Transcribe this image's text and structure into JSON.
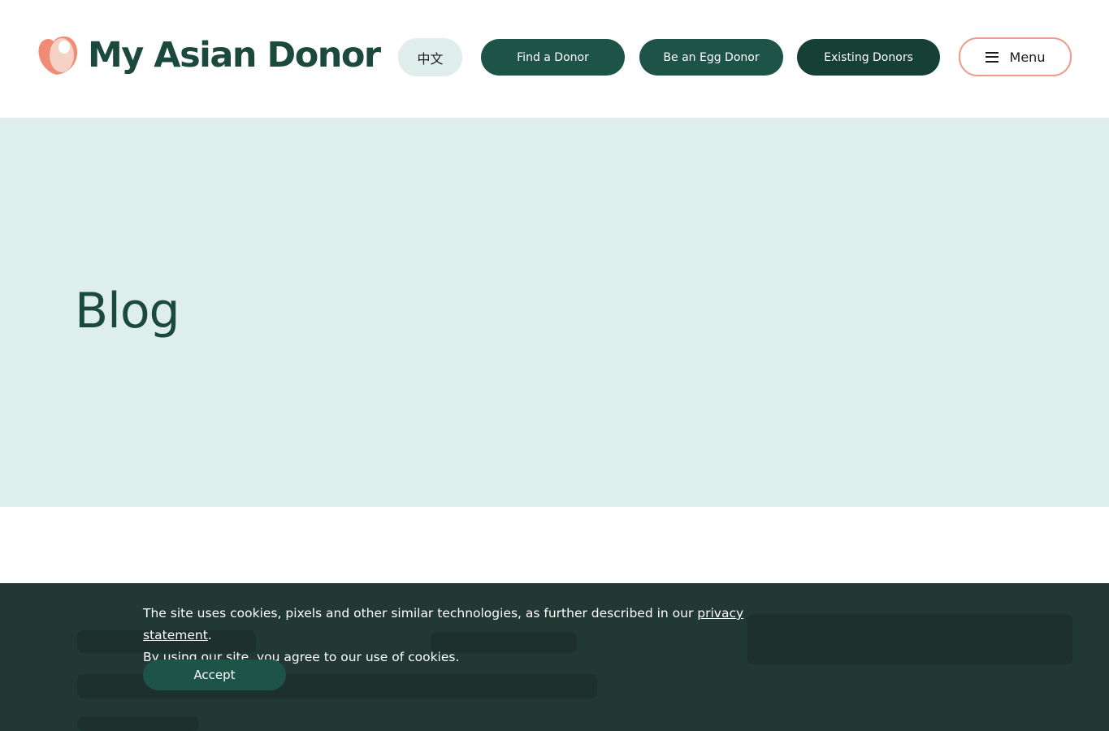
{
  "header": {
    "logo_text": "My Asian Donor",
    "lang_label": "中文",
    "nav": {
      "find_donor": "Find a Donor",
      "egg_donor": "Be an Egg Donor",
      "existing_donors": "Existing Donors"
    },
    "menu_label": "Menu"
  },
  "hero": {
    "title": "Blog"
  },
  "cookie_banner": {
    "text_before_link": "The site uses cookies, pixels and other similar technologies, as further described in our ",
    "link_text": "privacy statement",
    "text_after_link": ".",
    "line2": "By using our site, you agree to our use of cookies.",
    "accept_label": "Accept"
  },
  "colors": {
    "brand_green": "#1e5447",
    "dark_green": "#163f36",
    "hero_bg": "#deeeea",
    "accent_coral": "#ee9c8a",
    "cookie_bg": "#223832"
  },
  "icons": {
    "logo": "egg-heart-icon",
    "menu": "hamburger-icon"
  }
}
